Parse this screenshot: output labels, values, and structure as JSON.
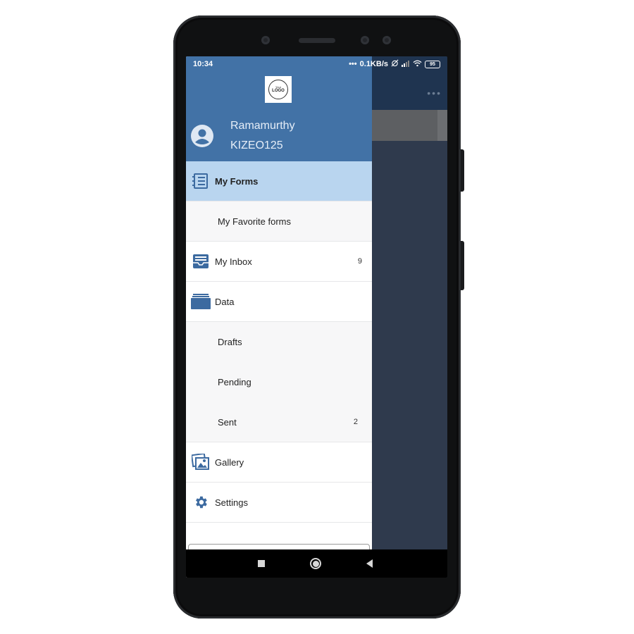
{
  "status_bar": {
    "time": "10:34",
    "network_speed": "0.1KB/s",
    "battery": "95"
  },
  "drawer": {
    "logo": {
      "line1": "Your",
      "line2": "LOGO"
    },
    "user": {
      "name": "Ramamurthy",
      "id": "KIZEO125"
    },
    "items": [
      {
        "label": "My Forms",
        "icon": "forms-icon",
        "active": true
      },
      {
        "label": "My Favorite forms",
        "sub": true
      },
      {
        "label": "My Inbox",
        "icon": "inbox-icon",
        "badge": "9"
      },
      {
        "label": "Data",
        "icon": "data-folder-icon"
      },
      {
        "label": "Drafts",
        "sub": true
      },
      {
        "label": "Pending",
        "sub": true
      },
      {
        "label": "Sent",
        "sub": true,
        "badge": "2"
      },
      {
        "label": "Gallery",
        "icon": "gallery-icon"
      },
      {
        "label": "Settings",
        "icon": "gear-icon"
      }
    ]
  },
  "colors": {
    "header": "#4272a6",
    "active_item": "#b9d5ef",
    "icon": "#3c6aa0"
  }
}
